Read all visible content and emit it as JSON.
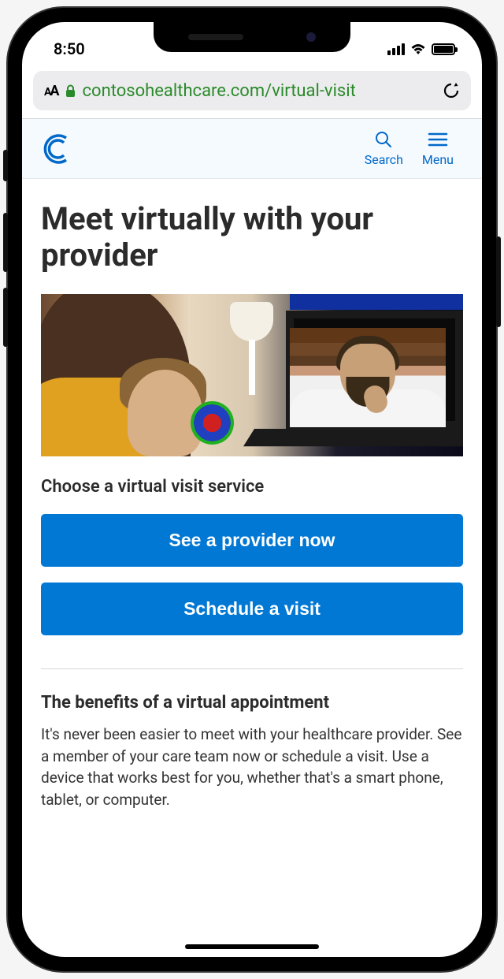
{
  "status": {
    "time": "8:50"
  },
  "browser": {
    "url": "contosohealthcare.com/virtual-visit"
  },
  "header": {
    "search_label": "Search",
    "menu_label": "Menu"
  },
  "main": {
    "title": "Meet virtually with your provider",
    "choose_title": "Choose a virtual visit service",
    "cta_primary": "See a provider now",
    "cta_secondary": "Schedule a visit",
    "benefits_title": "The benefits of a virtual appointment",
    "benefits_body": "It's never been easier to meet with your healthcare provider. See a member of your care team now or schedule a visit. Use a device that works best for you, whether that's a smart phone, tablet, or computer."
  },
  "colors": {
    "accent": "#0078d4",
    "link": "#0068c9",
    "url_green": "#2a8a2a"
  }
}
